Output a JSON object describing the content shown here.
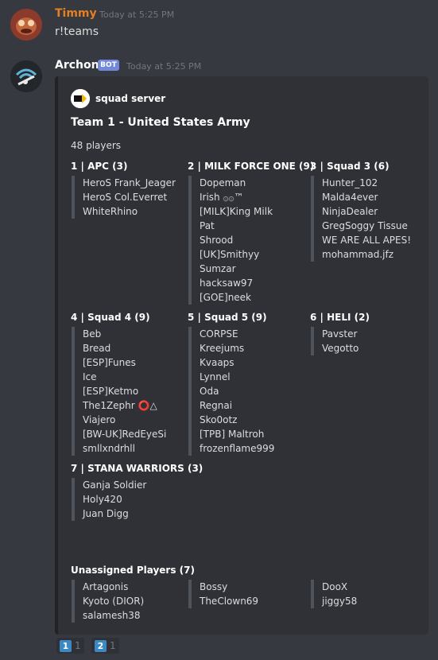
{
  "messages": [
    {
      "user": "Timmy",
      "time": "Today at 5:25 PM",
      "text": "r!teams",
      "color": "#e67e22"
    },
    {
      "user": "Archon",
      "badge": "BOT",
      "time": "Today at 5:25 PM"
    }
  ],
  "embed": {
    "author": "squad server",
    "title": "Team 1 - United States Army",
    "description": "48 players",
    "fields": [
      {
        "name": "1 | APC (3)",
        "values": [
          "HeroS Frank_Jeager",
          "HeroS Col.Everret",
          "WhiteRhino"
        ]
      },
      {
        "name": "2 | MILK FORCE ONE (9)",
        "values": [
          "Dopeman",
          "Irish ۞۞™",
          "[MILK]King Milk",
          "Pat",
          "Shrood",
          "[UK]Smithyy",
          "Sumzar",
          "hacksaw97",
          "[GOE]neek"
        ]
      },
      {
        "name": "3 | Squad 3 (6)",
        "values": [
          "Hunter_102",
          "Malda4ever",
          "NinjaDealer",
          "GregSoggy Tissue",
          "WE ARE ALL APES!",
          "mohammad.jfz"
        ]
      },
      {
        "name": "4 | Squad 4 (9)",
        "values": [
          "Beb",
          "Bread",
          "[ESP]Funes",
          "Ice",
          "[ESP]Ketmo",
          "The1Zephr ⭕△",
          "Viajero",
          "[BW-UK]RedEyeSi",
          "smllxndrhll"
        ]
      },
      {
        "name": "5 | Squad 5 (9)",
        "values": [
          "CORPSE",
          "Kreejums",
          "Kvaaps",
          "Lynnel",
          "Oda",
          "Regnai",
          "Sko0otz",
          "[TPB] Maltroh",
          "frozenflame999"
        ]
      },
      {
        "name": "6 | HELI (2)",
        "values": [
          "Pavster",
          "Vegotto"
        ]
      },
      {
        "name": "7 | STANA WARRIORS (3)",
        "values": [
          "Ganja Soldier",
          "Holy420",
          "Juan Digg"
        ]
      },
      {
        "name": "Unassigned Players (7)",
        "values": [
          "Artagonis",
          "Kyoto (DIOR)",
          "salamesh38"
        ]
      },
      {
        "name": "",
        "values": [
          "Bossy",
          "TheClown69"
        ]
      },
      {
        "name": "",
        "values": [
          "DooX",
          "jiggy58"
        ]
      }
    ]
  },
  "reactions": [
    {
      "emoji": "1",
      "count": "1"
    },
    {
      "emoji": "2",
      "count": "1"
    }
  ]
}
